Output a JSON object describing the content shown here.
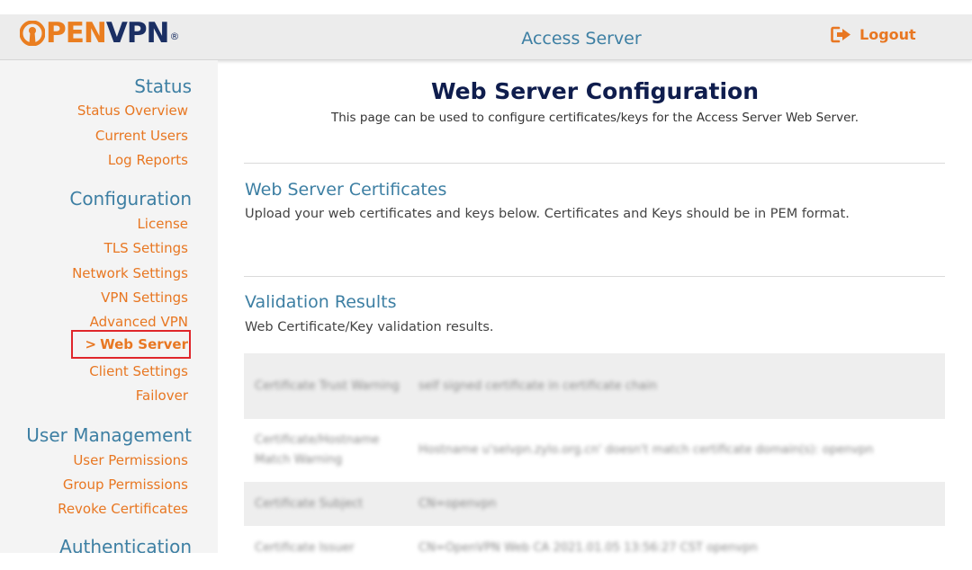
{
  "header": {
    "logo": {
      "text_pen": "PEN",
      "text_vpn": "VPN",
      "registered": "®"
    },
    "app_title": "Access Server",
    "logout_label": "Logout"
  },
  "sidebar": {
    "sections": [
      {
        "title": "Status",
        "items": [
          "Status Overview",
          "Current Users",
          "Log Reports"
        ]
      },
      {
        "title": "Configuration",
        "items": [
          "License",
          "TLS Settings",
          "Network Settings",
          "VPN Settings",
          "Advanced VPN",
          "Web Server",
          "Client Settings",
          "Failover"
        ]
      },
      {
        "title": "User Management",
        "items": [
          "User Permissions",
          "Group Permissions",
          "Revoke Certificates"
        ]
      },
      {
        "title": "Authentication",
        "items": []
      }
    ],
    "active_item": "Web Server",
    "active_chevron": ">"
  },
  "main": {
    "title": "Web Server Configuration",
    "description": "This page can be used to configure certificates/keys for the Access Server Web Server.",
    "certificates": {
      "title": "Web Server Certificates",
      "description": "Upload your web certificates and keys below. Certificates and Keys should be in PEM format."
    },
    "validation": {
      "title": "Validation Results",
      "description": "Web Certificate/Key validation results.",
      "rows": [
        {
          "label": "Certificate Trust Warning",
          "value": "self signed certificate in certificate chain"
        },
        {
          "label": "Certificate/Hostname Match Warning",
          "value": "Hostname u'selvpn.zylo.org.cn' doesn't match certificate domain(s): openvpn"
        },
        {
          "label": "Certificate Subject",
          "value": "CN=openvpn"
        },
        {
          "label": "Certificate Issuer",
          "value": "CN=OpenVPN Web CA 2021.01.05 13:56:27 CST openvpn"
        }
      ]
    }
  },
  "colors": {
    "accent_orange": "#e87722",
    "link_blue": "#3d7fa3",
    "title_navy": "#0f1d4d",
    "active_outline": "#e0262b"
  },
  "icons": {
    "logout": "sign-out-icon",
    "logo": "openvpn-keyhole-icon"
  }
}
